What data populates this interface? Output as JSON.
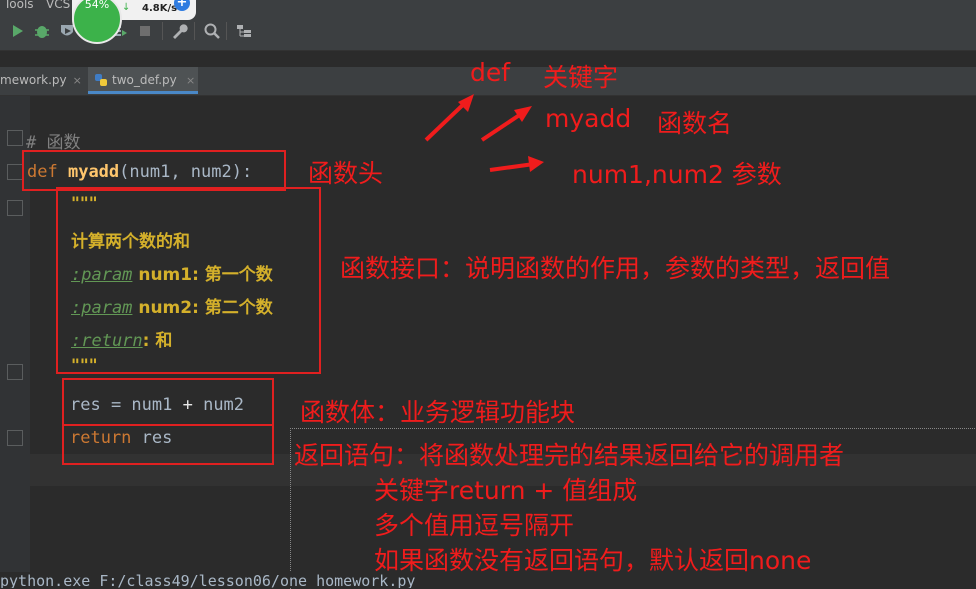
{
  "menu": {
    "tools": "Tools",
    "vcs": "VCS"
  },
  "speed_widget": {
    "cpu_percent": "54%",
    "download_arrow": "↓",
    "rate": "4.8K/s",
    "plus": "+"
  },
  "toolbar": {
    "icons": [
      "run-icon",
      "debug-icon",
      "coverage-icon",
      "profile-icon",
      "concurrency-icon",
      "stop-icon",
      "wrench-icon",
      "search-icon",
      "structure-icon"
    ]
  },
  "tabs": [
    {
      "label": "mework.py",
      "close": "×",
      "active": false
    },
    {
      "label": "two_def.py",
      "close": "×",
      "active": true
    }
  ],
  "code": {
    "comment": "# 函数",
    "def_kw": "def",
    "fn_name": "myadd",
    "params": "(num1, num2):",
    "doc_open": "\"\"\"",
    "doc_line1": "计算两个数的和",
    "param_tag": ":param",
    "param1": " num1: 第一个数",
    "param2": " num2: 第二个数",
    "return_tag": ":return",
    "return_desc": ": 和",
    "doc_close": "\"\"\"",
    "body_res": "res = num1 ",
    "body_plus": "+",
    "body_num2": " num2",
    "return_kw": "return",
    "return_val": " res"
  },
  "annotations": {
    "def_label": "def",
    "keyword_label": "关键字",
    "myadd_label": "myadd",
    "fn_name_label": "函数名",
    "params_label": "num1,num2 参数",
    "fn_head_label": "函数头",
    "interface_label": "函数接口：说明函数的作用，参数的类型，返回值",
    "body_label": "函数体：业务逻辑功能块",
    "return_label": "返回语句：将函数处理完的结果返回给它的调用者",
    "return_note1": "关键字return + 值组成",
    "return_note2": "多个值用逗号隔开",
    "return_note3": "如果函数没有返回语句，默认返回none"
  },
  "console": {
    "text": "python.exe F:/class49/lesson06/one_homework.py"
  },
  "colors": {
    "annotation_red": "#f01c1c",
    "editor_bg": "#2b2b2b",
    "keyword": "#cc7832",
    "function": "#ffc66d",
    "docstring": "#d4b02b"
  }
}
